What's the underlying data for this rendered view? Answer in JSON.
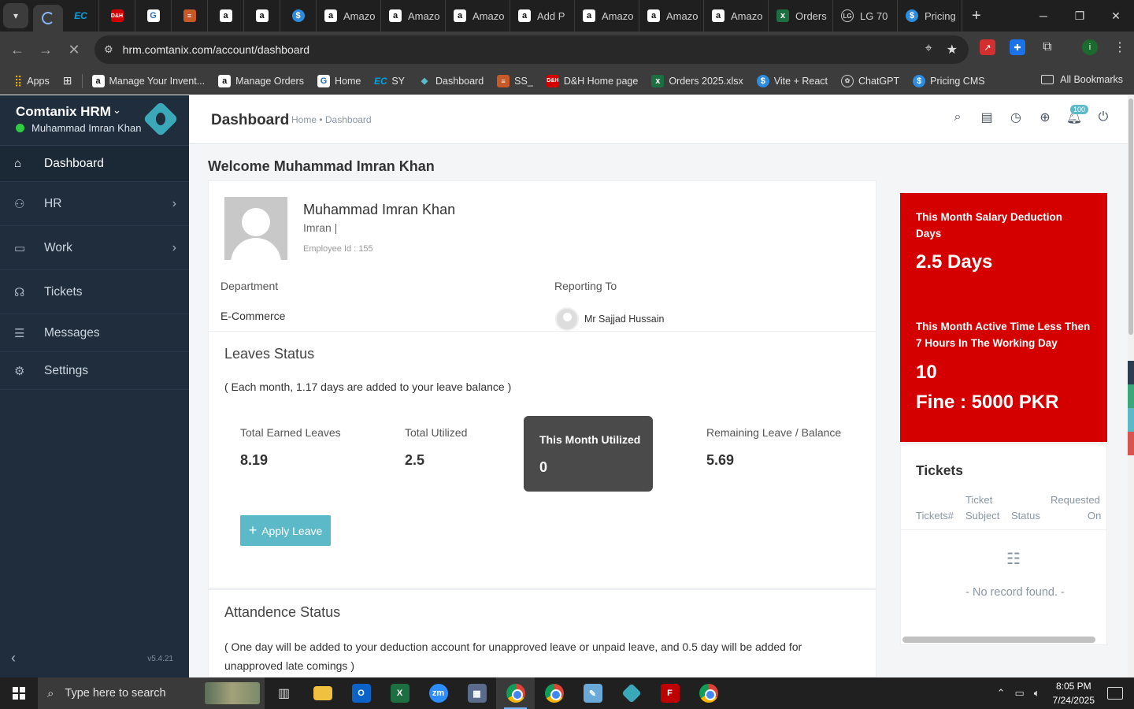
{
  "browser": {
    "tabs": [
      {
        "icon": "ec-favicon",
        "label": ""
      },
      {
        "icon": "dh-favicon",
        "label": ""
      },
      {
        "icon": "g-favicon",
        "label": ""
      },
      {
        "icon": "stack-favicon",
        "label": ""
      },
      {
        "icon": "amazon-favicon",
        "label": ""
      },
      {
        "icon": "amazon-favicon",
        "label": ""
      },
      {
        "icon": "dollar-favicon",
        "label": ""
      },
      {
        "icon": "amazon-favicon",
        "label": "Amazo"
      },
      {
        "icon": "amazon-favicon",
        "label": "Amazo"
      },
      {
        "icon": "amazon-favicon",
        "label": "Amazo"
      },
      {
        "icon": "amazon-favicon",
        "label": "Add P"
      },
      {
        "icon": "amazon-favicon",
        "label": "Amazo"
      },
      {
        "icon": "amazon-favicon",
        "label": "Amazo"
      },
      {
        "icon": "amazon-favicon",
        "label": "Amazo"
      },
      {
        "icon": "excel-favicon",
        "label": "Orders"
      },
      {
        "icon": "lg-favicon",
        "label": "LG 70"
      },
      {
        "icon": "dollar-favicon",
        "label": "Pricing"
      }
    ],
    "url": "hrm.comtanix.com/account/dashboard",
    "bookmarks": [
      {
        "label": "Apps",
        "icon": "apps-grid"
      },
      {
        "label": "Manage Your Invent...",
        "icon": "amazon"
      },
      {
        "label": "Manage Orders",
        "icon": "amazon"
      },
      {
        "label": "Home",
        "icon": "g"
      },
      {
        "label": "SY",
        "icon": "ec"
      },
      {
        "label": "Dashboard",
        "icon": "diamond"
      },
      {
        "label": "SS_",
        "icon": "stack"
      },
      {
        "label": "D&H Home page",
        "icon": "dh"
      },
      {
        "label": "Orders 2025.xlsx",
        "icon": "excel"
      },
      {
        "label": "Vite + React",
        "icon": "dollar"
      },
      {
        "label": "ChatGPT",
        "icon": "openai"
      },
      {
        "label": "Pricing CMS",
        "icon": "dollar"
      }
    ],
    "all_bookmarks": "All Bookmarks"
  },
  "sidebar": {
    "brand": "Comtanix HRM",
    "user": "Muhammad Imran Khan",
    "items": [
      {
        "label": "Dashboard",
        "icon": "home-icon",
        "active": true
      },
      {
        "label": "HR",
        "icon": "users-icon",
        "has_children": true
      },
      {
        "label": "Work",
        "icon": "briefcase-icon",
        "has_children": true
      },
      {
        "label": "Tickets",
        "icon": "headset-icon"
      },
      {
        "label": "Messages",
        "icon": "message-icon"
      },
      {
        "label": "Settings",
        "icon": "gear-icon"
      }
    ],
    "version": "v5.4.21"
  },
  "header": {
    "title": "Dashboard",
    "breadcrumb": "Home • Dashboard",
    "notification_count": "100"
  },
  "main": {
    "welcome": "Welcome Muhammad Imran Khan",
    "profile": {
      "name": "Muhammad Imran Khan",
      "nickname": "Imran |",
      "employee_id": "Employee Id : 155",
      "department_label": "Department",
      "department": "E-Commerce",
      "reporting_label": "Reporting To",
      "reporting_to": "Mr Sajjad Hussain"
    },
    "leaves": {
      "title": "Leaves Status",
      "note": "( Each month, 1.17 days are added to your leave balance )",
      "total_earned_label": "Total Earned Leaves",
      "total_earned": "8.19",
      "total_utilized_label": "Total Utilized",
      "total_utilized": "2.5",
      "this_month_label": "This Month Utilized",
      "this_month": "0",
      "remaining_label": "Remaining Leave / Balance",
      "remaining": "5.69",
      "apply_label": "Apply Leave"
    },
    "attendance": {
      "title": "Attandence Status",
      "note": "( One day will be added to your deduction account for unapproved leave or unpaid leave, and 0.5 day will be added for unapproved late comings )"
    }
  },
  "deduction": {
    "salary_label": "This Month Salary Deduction Days",
    "salary_value": "2.5 Days",
    "active_label": "This Month Active Time Less Then 7 Hours In The Working Day",
    "active_value": "10",
    "fine": "Fine : 5000 PKR"
  },
  "tickets": {
    "title": "Tickets",
    "col_number": "Tickets#",
    "col_subject_1": "Ticket",
    "col_subject_2": "Subject",
    "col_status": "Status",
    "col_requested_1": "Requested",
    "col_requested_2": "On",
    "empty": "- No record found. -"
  },
  "taskbar": {
    "search_placeholder": "Type here to search",
    "time": "8:05 PM",
    "date": "7/24/2025"
  },
  "colors": {
    "sidebar_bg": "#1f2d3d",
    "accent": "#5bb9c8",
    "deduction_red": "#d40000",
    "dark_stat": "#4a4a4a"
  }
}
